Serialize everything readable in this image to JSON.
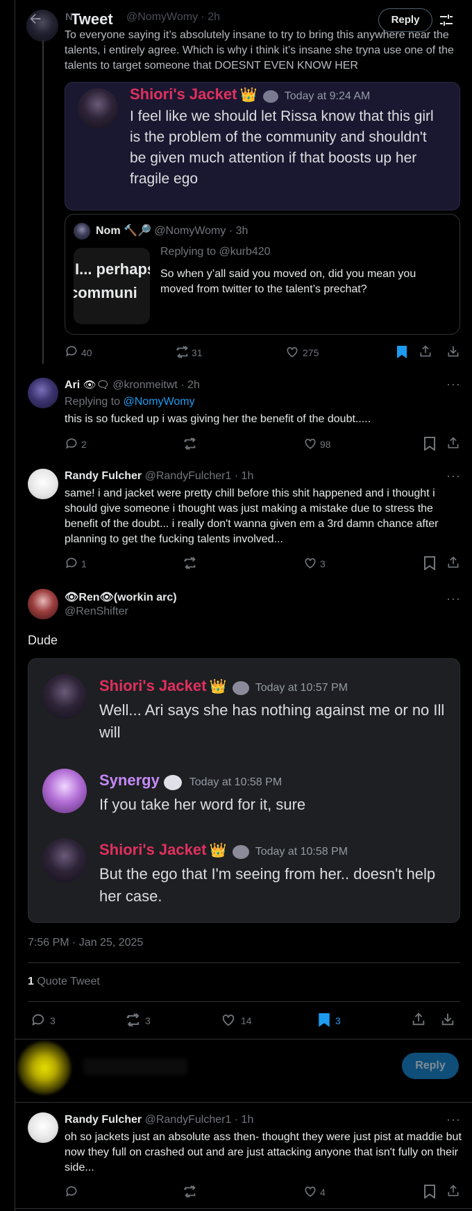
{
  "header": {
    "back_icon": "arrow-left-icon",
    "title": "Tweet",
    "reply_label": "Reply",
    "settings_icon": "sliders-icon"
  },
  "tweet1": {
    "name": "N",
    "handle": "@NomyWomy · 2h",
    "text": "To everyone saying it’s absolutely insane to try to bring this anywhere near the talents, i entirely agree. Which is why i think it’s insane she tryna use one of the talents to target someone that DOESNT EVEN KNOW HER",
    "discord": {
      "name": "Shiori's Jacket",
      "badge": "👑",
      "time": "Today at 9:24 AM",
      "text": "I feel like we should let Rissa know that this girl is the problem of the community and shouldn't be given much attention if that boosts up her fragile ego"
    },
    "quote": {
      "name": "Nom",
      "emoji": "🔨🔎",
      "handle": "@NomyWomy · 3h",
      "thumb_lines": [
        "I... perhaps",
        "communi"
      ],
      "replying": "Replying to @kurb420",
      "text": "So when y’all said you moved on, did you mean you moved from twitter to the talent’s prechat?"
    },
    "replies": "40",
    "retweets": "31",
    "likes": "275"
  },
  "tweet2": {
    "name": "Ari",
    "emoji": "👁🗨",
    "handle": "@kronmeitwt · 2h",
    "replying_prefix": "Replying to",
    "replying_user": "@NomyWomy",
    "text": "this is so fucked up i was giving her the benefit of the doubt.....",
    "replies": "2",
    "likes": "98"
  },
  "tweet3": {
    "name": "Randy Fulcher",
    "handle": "@RandyFulcher1 · 1h",
    "text": "same! i and jacket were pretty chill before this shit happened and i thought i should give someone i thought was just making a mistake due to stress the benefit of the doubt... i really don't wanna given em a 3rd damn chance after planning to get the fucking talents involved...",
    "replies": "1",
    "likes": "3"
  },
  "main": {
    "name": "👁Ren👁(workin arc)",
    "handle": "@RenShifter",
    "text": "Dude",
    "messages": [
      {
        "name": "Shiori's Jacket",
        "badge": "👑",
        "time": "Today at 10:57 PM",
        "text": "Well... Ari says she has nothing against me or no Ill will",
        "color": "#e0305f"
      },
      {
        "name": "Synergy",
        "badge": "",
        "time": "Today at 10:58 PM",
        "text": "If you take her word for it, sure",
        "color": "#c58af9"
      },
      {
        "name": "Shiori's Jacket",
        "badge": "👑",
        "time": "Today at 10:58 PM",
        "text": "But the ego that I'm seeing from her.. doesn't help her case.",
        "color": "#e0305f"
      }
    ],
    "timestamp": "7:56 PM · Jan 25, 2025",
    "quote_count": "1",
    "quote_label": "Quote Tweet",
    "replies": "3",
    "retweets": "3",
    "likes": "14",
    "bookmarks": "3"
  },
  "compose": {
    "reply_label": "Reply"
  },
  "tweet4": {
    "name": "Randy Fulcher",
    "handle": "@RandyFulcher1 · 1h",
    "text": "oh so jackets just an absolute ass then- thought they were just pist at maddie but now they full on crashed out and are just attacking anyone that isn't fully on their side...",
    "likes": "4"
  },
  "colors": {
    "accent": "#1d9bf0",
    "discord_red": "#e0305f",
    "discord_purple": "#c58af9"
  }
}
